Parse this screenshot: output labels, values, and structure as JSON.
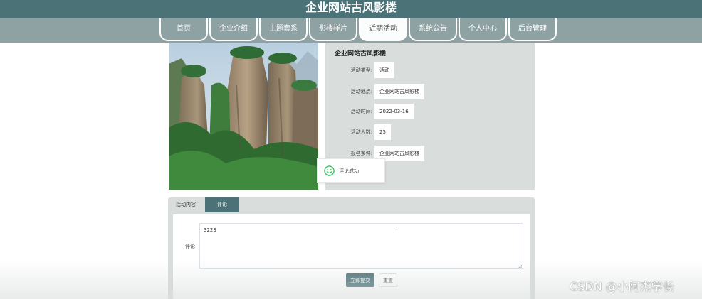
{
  "header": {
    "title": "企业网站古风影楼"
  },
  "nav": {
    "items": [
      {
        "label": "首页"
      },
      {
        "label": "企业介绍"
      },
      {
        "label": "主题套系"
      },
      {
        "label": "影楼样片"
      },
      {
        "label": "近期活动"
      },
      {
        "label": "系统公告"
      },
      {
        "label": "个人中心"
      },
      {
        "label": "后台管理"
      }
    ],
    "active_index": 4
  },
  "activity": {
    "title": "企业网站古风影楼",
    "fields": [
      {
        "label": "活动类型:",
        "value": "活动"
      },
      {
        "label": "活动地点:",
        "value": "企业网站古风影楼"
      },
      {
        "label": "活动时间:",
        "value": "2022-03-16"
      },
      {
        "label": "活动人数:",
        "value": "25"
      },
      {
        "label": "报名条件:",
        "value": "企业网站古风影楼"
      }
    ]
  },
  "toast": {
    "text": "评论成功",
    "icon": "smile-icon"
  },
  "tabs": [
    {
      "label": "活动内容"
    },
    {
      "label": "评论"
    }
  ],
  "comment_form": {
    "label": "评论",
    "value": "3223",
    "submit_label": "立即提交",
    "reset_label": "重置"
  },
  "watermark": "CSDN @小阿杰学长",
  "colors": {
    "primary": "#4a7277",
    "nav_bg": "#8fa2a3",
    "panel_bg": "#d9dddc",
    "toast_icon": "#2fc25b"
  }
}
